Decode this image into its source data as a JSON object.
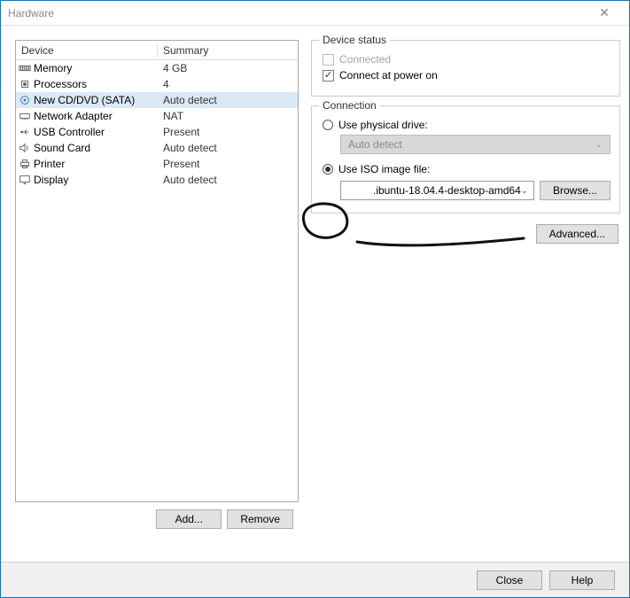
{
  "window": {
    "title": "Hardware"
  },
  "list": {
    "headers": {
      "device": "Device",
      "summary": "Summary"
    },
    "items": [
      {
        "icon": "memory",
        "name": "Memory",
        "summary": "4 GB",
        "selected": false
      },
      {
        "icon": "cpu",
        "name": "Processors",
        "summary": "4",
        "selected": false
      },
      {
        "icon": "disc",
        "name": "New CD/DVD (SATA)",
        "summary": "Auto detect",
        "selected": true
      },
      {
        "icon": "net",
        "name": "Network Adapter",
        "summary": "NAT",
        "selected": false
      },
      {
        "icon": "usb",
        "name": "USB Controller",
        "summary": "Present",
        "selected": false
      },
      {
        "icon": "sound",
        "name": "Sound Card",
        "summary": "Auto detect",
        "selected": false
      },
      {
        "icon": "printer",
        "name": "Printer",
        "summary": "Present",
        "selected": false
      },
      {
        "icon": "display",
        "name": "Display",
        "summary": "Auto detect",
        "selected": false
      }
    ],
    "buttons": {
      "add": "Add...",
      "remove": "Remove"
    }
  },
  "status": {
    "legend": "Device status",
    "connected_label": "Connected",
    "connect_power_label": "Connect at power on",
    "connected_checked": false,
    "connect_power_checked": true
  },
  "connection": {
    "legend": "Connection",
    "physical_label": "Use physical drive:",
    "physical_selected": false,
    "physical_value": "Auto detect",
    "iso_label": "Use ISO image file:",
    "iso_selected": true,
    "iso_value": ".ibuntu-18.04.4-desktop-amd64",
    "browse": "Browse...",
    "advanced": "Advanced..."
  },
  "footer": {
    "close": "Close",
    "help": "Help"
  }
}
